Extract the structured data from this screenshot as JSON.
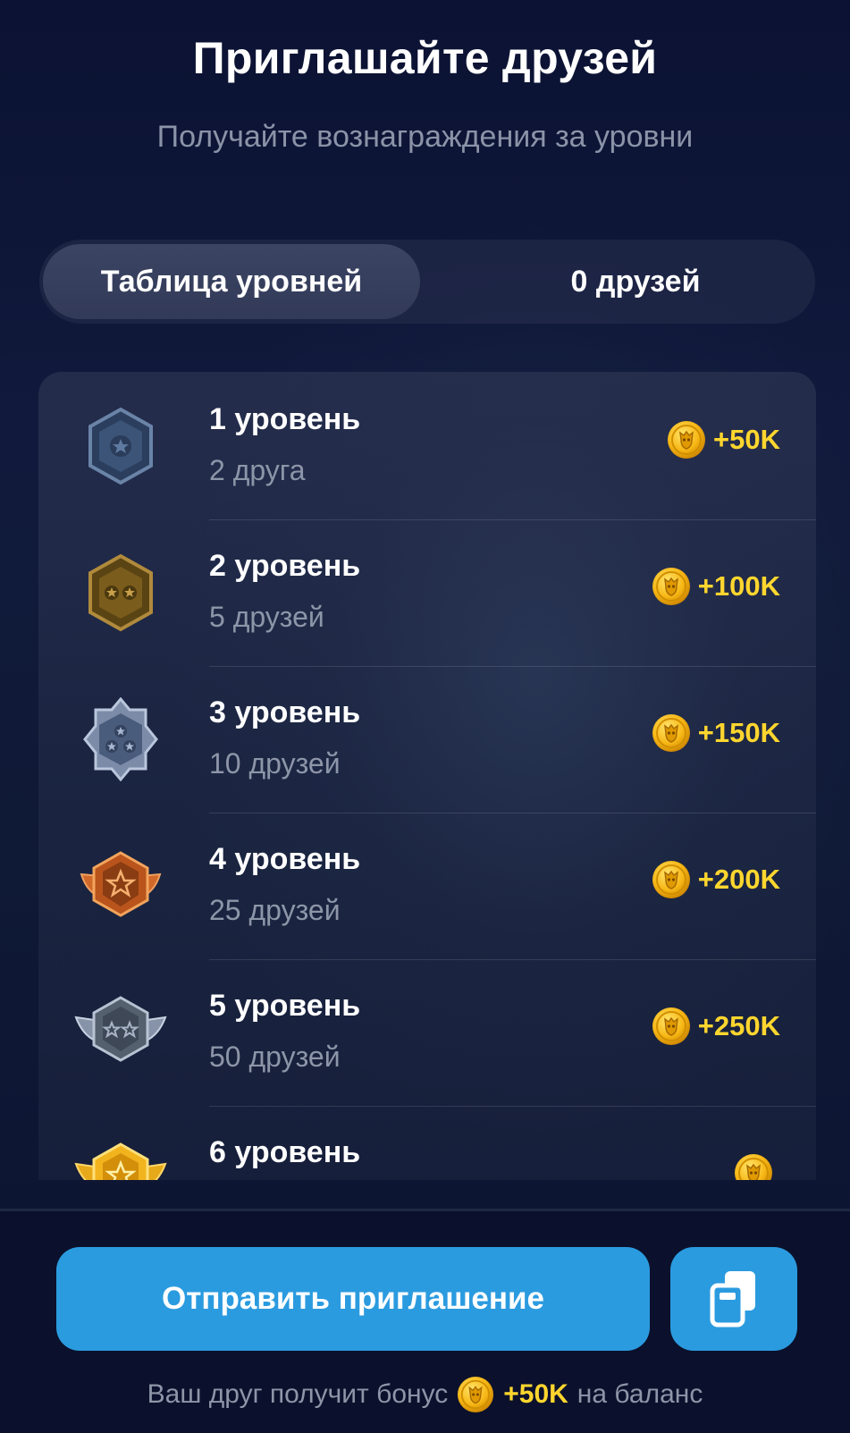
{
  "header": {
    "title": "Приглашайте друзей",
    "subtitle": "Получайте вознаграждения за уровни"
  },
  "tabs": [
    {
      "label": "Таблица уровней",
      "active": true
    },
    {
      "label": "0 друзей",
      "active": false
    }
  ],
  "levels": [
    {
      "name": "1 уровень",
      "requirement": "2 друга",
      "reward": "+50K",
      "badge_icon": "steel-hexagon-star-badge"
    },
    {
      "name": "2 уровень",
      "requirement": "5 друзей",
      "reward": "+100K",
      "badge_icon": "bronze-hexagon-two-stars-badge"
    },
    {
      "name": "3 уровень",
      "requirement": "10 друзей",
      "reward": "+150K",
      "badge_icon": "silver-hexagon-three-stars-badge"
    },
    {
      "name": "4 уровень",
      "requirement": "25 друзей",
      "reward": "+200K",
      "badge_icon": "copper-winged-star-badge"
    },
    {
      "name": "5 уровень",
      "requirement": "50 друзей",
      "reward": "+250K",
      "badge_icon": "silver-winged-two-stars-badge"
    },
    {
      "name": "6 уровень",
      "requirement": "",
      "reward": "",
      "badge_icon": "gold-winged-star-badge"
    }
  ],
  "footer": {
    "invite_button_label": "Отправить приглашение",
    "copy_button_icon": "copy-icon",
    "bonus_prefix": "Ваш друг получит бонус",
    "bonus_value": "+50K",
    "bonus_suffix": "на баланс"
  },
  "colors": {
    "background": "#0b1233",
    "accent_blue": "#2b9be0",
    "reward_gold": "#ffd62e",
    "muted_text": "#8d95a8"
  }
}
